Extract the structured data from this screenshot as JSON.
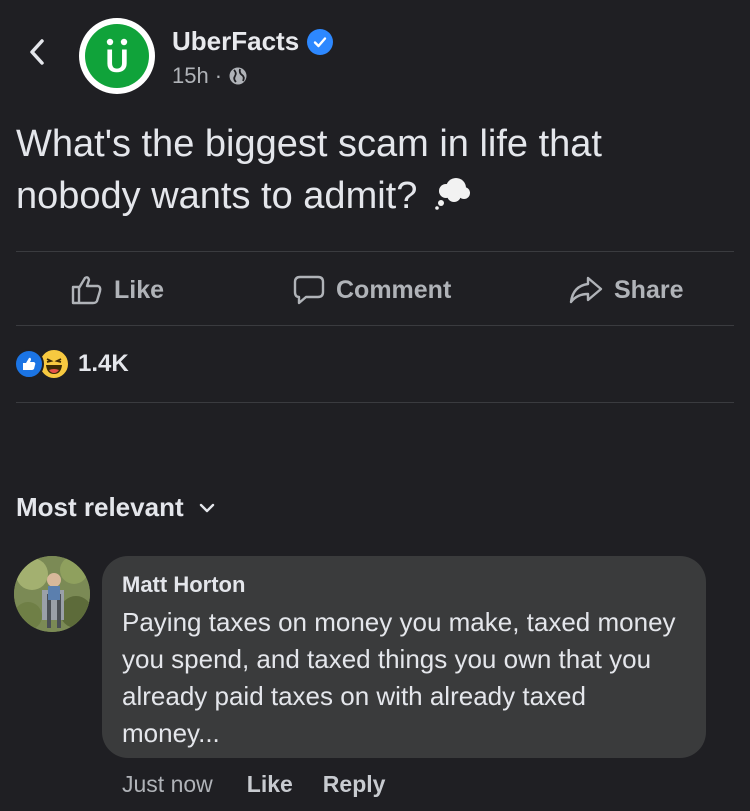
{
  "post": {
    "page_name": "UberFacts",
    "time": "15h",
    "separator": "·",
    "text": "What's the biggest scam in life that nobody wants to admit?",
    "logo_letter": "U"
  },
  "actions": {
    "like": "Like",
    "comment": "Comment",
    "share": "Share"
  },
  "reactions": {
    "count": "1.4K"
  },
  "comments": {
    "sort_label": "Most relevant",
    "items": [
      {
        "author": "Matt Horton",
        "text": "Paying taxes on money you make, taxed money you spend, and taxed things you own that you already paid taxes on with already taxed money...",
        "time": "Just now",
        "like": "Like",
        "reply": "Reply"
      }
    ]
  },
  "icons": {
    "back": "chevron-left-icon",
    "verified": "verified-badge-icon",
    "privacy": "globe-icon",
    "thought": "thought-balloon-icon",
    "like": "thumbs-up-icon",
    "comment": "comment-icon",
    "share": "share-arrow-icon",
    "sort": "chevron-down-icon"
  },
  "colors": {
    "background": "#1f1f23",
    "bubble": "#3a3b3c",
    "brand_green": "#10a33a",
    "verified_blue": "#2d88ff",
    "muted_text": "#b0b3b8"
  }
}
